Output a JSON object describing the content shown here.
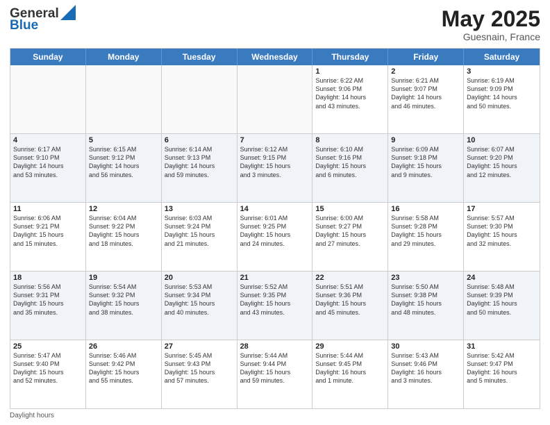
{
  "header": {
    "logo_general": "General",
    "logo_blue": "Blue",
    "month_title": "May 2025",
    "subtitle": "Guesnain, France"
  },
  "days_of_week": [
    "Sunday",
    "Monday",
    "Tuesday",
    "Wednesday",
    "Thursday",
    "Friday",
    "Saturday"
  ],
  "rows": [
    [
      {
        "day": "",
        "info": "",
        "empty": true
      },
      {
        "day": "",
        "info": "",
        "empty": true
      },
      {
        "day": "",
        "info": "",
        "empty": true
      },
      {
        "day": "",
        "info": "",
        "empty": true
      },
      {
        "day": "1",
        "info": "Sunrise: 6:22 AM\nSunset: 9:06 PM\nDaylight: 14 hours\nand 43 minutes.",
        "empty": false
      },
      {
        "day": "2",
        "info": "Sunrise: 6:21 AM\nSunset: 9:07 PM\nDaylight: 14 hours\nand 46 minutes.",
        "empty": false
      },
      {
        "day": "3",
        "info": "Sunrise: 6:19 AM\nSunset: 9:09 PM\nDaylight: 14 hours\nand 50 minutes.",
        "empty": false
      }
    ],
    [
      {
        "day": "4",
        "info": "Sunrise: 6:17 AM\nSunset: 9:10 PM\nDaylight: 14 hours\nand 53 minutes.",
        "empty": false
      },
      {
        "day": "5",
        "info": "Sunrise: 6:15 AM\nSunset: 9:12 PM\nDaylight: 14 hours\nand 56 minutes.",
        "empty": false
      },
      {
        "day": "6",
        "info": "Sunrise: 6:14 AM\nSunset: 9:13 PM\nDaylight: 14 hours\nand 59 minutes.",
        "empty": false
      },
      {
        "day": "7",
        "info": "Sunrise: 6:12 AM\nSunset: 9:15 PM\nDaylight: 15 hours\nand 3 minutes.",
        "empty": false
      },
      {
        "day": "8",
        "info": "Sunrise: 6:10 AM\nSunset: 9:16 PM\nDaylight: 15 hours\nand 6 minutes.",
        "empty": false
      },
      {
        "day": "9",
        "info": "Sunrise: 6:09 AM\nSunset: 9:18 PM\nDaylight: 15 hours\nand 9 minutes.",
        "empty": false
      },
      {
        "day": "10",
        "info": "Sunrise: 6:07 AM\nSunset: 9:20 PM\nDaylight: 15 hours\nand 12 minutes.",
        "empty": false
      }
    ],
    [
      {
        "day": "11",
        "info": "Sunrise: 6:06 AM\nSunset: 9:21 PM\nDaylight: 15 hours\nand 15 minutes.",
        "empty": false
      },
      {
        "day": "12",
        "info": "Sunrise: 6:04 AM\nSunset: 9:22 PM\nDaylight: 15 hours\nand 18 minutes.",
        "empty": false
      },
      {
        "day": "13",
        "info": "Sunrise: 6:03 AM\nSunset: 9:24 PM\nDaylight: 15 hours\nand 21 minutes.",
        "empty": false
      },
      {
        "day": "14",
        "info": "Sunrise: 6:01 AM\nSunset: 9:25 PM\nDaylight: 15 hours\nand 24 minutes.",
        "empty": false
      },
      {
        "day": "15",
        "info": "Sunrise: 6:00 AM\nSunset: 9:27 PM\nDaylight: 15 hours\nand 27 minutes.",
        "empty": false
      },
      {
        "day": "16",
        "info": "Sunrise: 5:58 AM\nSunset: 9:28 PM\nDaylight: 15 hours\nand 29 minutes.",
        "empty": false
      },
      {
        "day": "17",
        "info": "Sunrise: 5:57 AM\nSunset: 9:30 PM\nDaylight: 15 hours\nand 32 minutes.",
        "empty": false
      }
    ],
    [
      {
        "day": "18",
        "info": "Sunrise: 5:56 AM\nSunset: 9:31 PM\nDaylight: 15 hours\nand 35 minutes.",
        "empty": false
      },
      {
        "day": "19",
        "info": "Sunrise: 5:54 AM\nSunset: 9:32 PM\nDaylight: 15 hours\nand 38 minutes.",
        "empty": false
      },
      {
        "day": "20",
        "info": "Sunrise: 5:53 AM\nSunset: 9:34 PM\nDaylight: 15 hours\nand 40 minutes.",
        "empty": false
      },
      {
        "day": "21",
        "info": "Sunrise: 5:52 AM\nSunset: 9:35 PM\nDaylight: 15 hours\nand 43 minutes.",
        "empty": false
      },
      {
        "day": "22",
        "info": "Sunrise: 5:51 AM\nSunset: 9:36 PM\nDaylight: 15 hours\nand 45 minutes.",
        "empty": false
      },
      {
        "day": "23",
        "info": "Sunrise: 5:50 AM\nSunset: 9:38 PM\nDaylight: 15 hours\nand 48 minutes.",
        "empty": false
      },
      {
        "day": "24",
        "info": "Sunrise: 5:48 AM\nSunset: 9:39 PM\nDaylight: 15 hours\nand 50 minutes.",
        "empty": false
      }
    ],
    [
      {
        "day": "25",
        "info": "Sunrise: 5:47 AM\nSunset: 9:40 PM\nDaylight: 15 hours\nand 52 minutes.",
        "empty": false
      },
      {
        "day": "26",
        "info": "Sunrise: 5:46 AM\nSunset: 9:42 PM\nDaylight: 15 hours\nand 55 minutes.",
        "empty": false
      },
      {
        "day": "27",
        "info": "Sunrise: 5:45 AM\nSunset: 9:43 PM\nDaylight: 15 hours\nand 57 minutes.",
        "empty": false
      },
      {
        "day": "28",
        "info": "Sunrise: 5:44 AM\nSunset: 9:44 PM\nDaylight: 15 hours\nand 59 minutes.",
        "empty": false
      },
      {
        "day": "29",
        "info": "Sunrise: 5:44 AM\nSunset: 9:45 PM\nDaylight: 16 hours\nand 1 minute.",
        "empty": false
      },
      {
        "day": "30",
        "info": "Sunrise: 5:43 AM\nSunset: 9:46 PM\nDaylight: 16 hours\nand 3 minutes.",
        "empty": false
      },
      {
        "day": "31",
        "info": "Sunrise: 5:42 AM\nSunset: 9:47 PM\nDaylight: 16 hours\nand 5 minutes.",
        "empty": false
      }
    ]
  ],
  "footer": "Daylight hours"
}
